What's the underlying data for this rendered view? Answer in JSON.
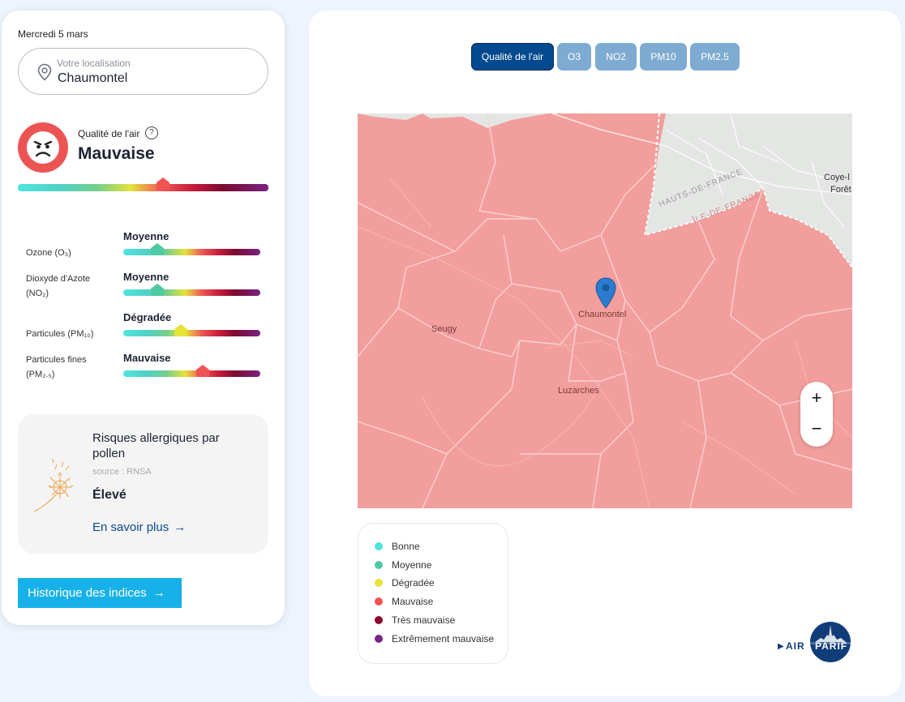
{
  "sidebar": {
    "date": "Mercredi 5 mars",
    "location": {
      "label": "Votre localisation",
      "value": "Chaumontel"
    },
    "air_quality": {
      "title": "Qualité de l'air",
      "value": "Mauvaise",
      "level_fraction": 0.58
    },
    "pollutants": [
      {
        "label": "Ozone (O₃)",
        "value": "Moyenne",
        "level_fraction": 0.25,
        "color": "#4fc9a3"
      },
      {
        "label": "Dioxyde d'Azote (NO₂)",
        "value": "Moyenne",
        "level_fraction": 0.25,
        "color": "#4fc9a3"
      },
      {
        "label": "Particules (PM₁₀)",
        "value": "Dégradée",
        "level_fraction": 0.42,
        "color": "#e6e33a"
      },
      {
        "label": "Particules fines (PM₂.₅)",
        "value": "Mauvaise",
        "level_fraction": 0.58,
        "color": "#f05452"
      }
    ],
    "pollen": {
      "title": "Risques allergiques par pollen",
      "source": "source : RNSA",
      "level": "Élevé",
      "link": "En savoir plus"
    },
    "history_button": "Historique des indices"
  },
  "tabs": [
    {
      "label": "Qualité de l'air",
      "active": true
    },
    {
      "label": "O3",
      "active": false
    },
    {
      "label": "NO2",
      "active": false
    },
    {
      "label": "PM10",
      "active": false
    },
    {
      "label": "PM2.5",
      "active": false
    }
  ],
  "map": {
    "labels": {
      "chaumontel": "Chaumontel",
      "seugy": "Seugy",
      "luzarches": "Luzarches",
      "coye": "Coye-l",
      "foret": "Forêt",
      "hauts_de_france": "HAUTS-DE-FRANCE",
      "ile_de_france": "ÎLE-DE-FRANCE"
    },
    "zoom_in": "+",
    "zoom_out": "−",
    "fill_color": "#f29e9c"
  },
  "legend": [
    {
      "label": "Bonne",
      "color": "#50e5de"
    },
    {
      "label": "Moyenne",
      "color": "#4fc9a3"
    },
    {
      "label": "Dégradée",
      "color": "#e6e33a"
    },
    {
      "label": "Mauvaise",
      "color": "#f05452"
    },
    {
      "label": "Très mauvaise",
      "color": "#8a0a2e"
    },
    {
      "label": "Extrêmement mauvaise",
      "color": "#7a2384"
    }
  ],
  "logo": {
    "left": "AIR",
    "right": "PARIF"
  },
  "icons": {
    "location": "location-pin-icon",
    "face": "angry-face-icon",
    "help": "help-circle-icon",
    "pollen": "dandelion-icon",
    "arrow": "arrow-right-icon",
    "map_marker": "map-marker-icon"
  }
}
